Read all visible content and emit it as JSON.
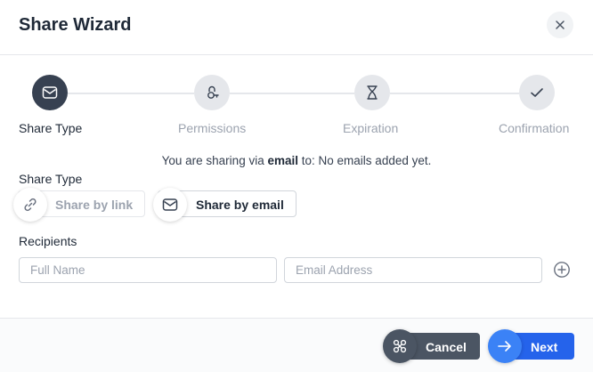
{
  "dialog": {
    "title": "Share Wizard",
    "close_icon": "close-icon"
  },
  "steps": [
    {
      "label": "Share Type",
      "icon": "envelope-icon",
      "active": true
    },
    {
      "label": "Permissions",
      "icon": "key-icon",
      "active": false
    },
    {
      "label": "Expiration",
      "icon": "hourglass-icon",
      "active": false
    },
    {
      "label": "Confirmation",
      "icon": "check-icon",
      "active": false
    }
  ],
  "summary": {
    "prefix": "You are sharing via",
    "method": "email",
    "suffix": "to: No emails added yet."
  },
  "share_type": {
    "label": "Share Type",
    "options": [
      {
        "label": "Share by link",
        "icon": "link-icon",
        "selected": false
      },
      {
        "label": "Share by email",
        "icon": "envelope-icon",
        "selected": true
      }
    ]
  },
  "recipients": {
    "label": "Recipients",
    "name_placeholder": "Full Name",
    "email_placeholder": "Email Address",
    "add_icon": "plus-circle-icon"
  },
  "footer": {
    "cancel_label": "Cancel",
    "next_label": "Next"
  },
  "colors": {
    "active_step": "#374151",
    "inactive_step": "#e5e7eb",
    "primary": "#2563eb",
    "secondary": "#4b5563"
  }
}
